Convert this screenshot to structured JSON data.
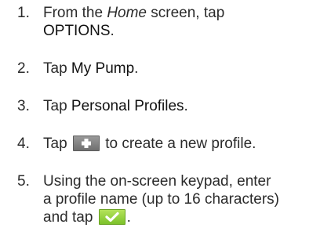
{
  "steps": [
    {
      "number": "1.",
      "line1_prefix": "From the ",
      "line1_screen": "Home",
      "line1_suffix": " screen, tap",
      "line2_term": "OPTIONS",
      "line2_suffix": "."
    },
    {
      "number": "2.",
      "prefix": "Tap ",
      "term": "My Pump",
      "suffix": "."
    },
    {
      "number": "3.",
      "prefix": "Tap ",
      "term": "Personal Profiles",
      "suffix": "."
    },
    {
      "number": "4.",
      "prefix": "Tap ",
      "icon": "plus-icon",
      "suffix": " to create a new profile."
    },
    {
      "number": "5.",
      "line1": "Using the on-screen keypad, enter",
      "line2": "a profile name (up to 16 characters)",
      "line3_prefix": "and tap ",
      "icon": "checkmark-icon",
      "line3_suffix": "."
    }
  ],
  "colors": {
    "text": "#2b2b2b",
    "plus_button": "#7f7f7f",
    "check_button": "#8fd13a"
  }
}
